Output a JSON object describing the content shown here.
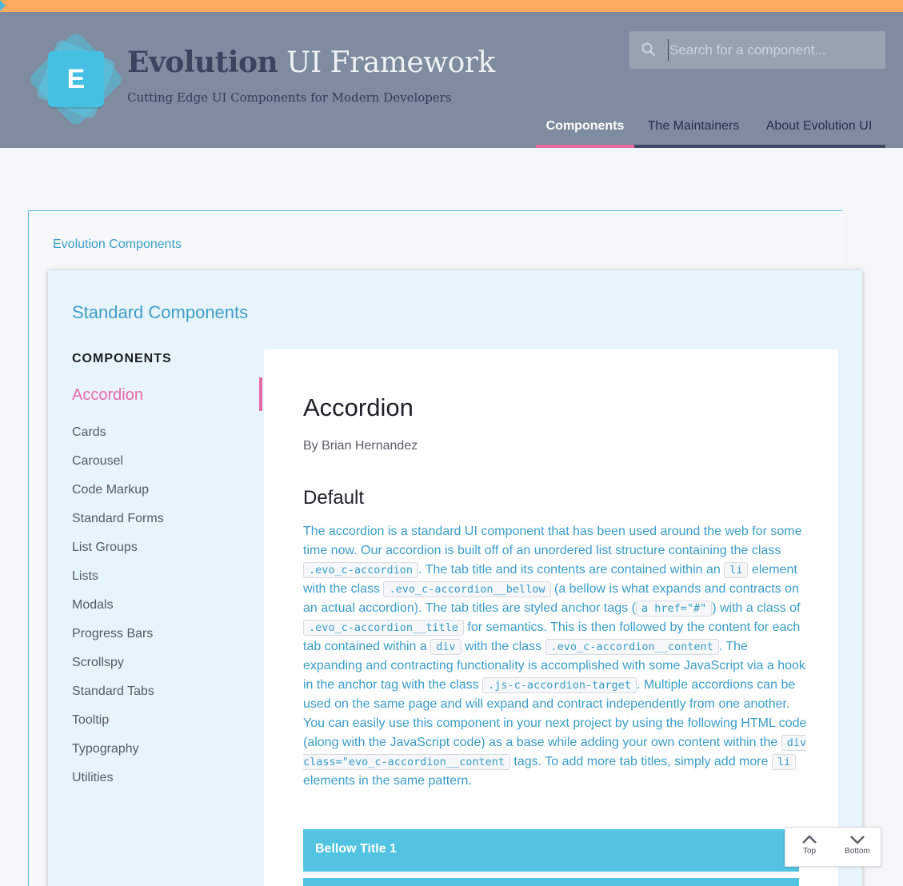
{
  "colors": {
    "accent_pink": "#e86aa4",
    "link_blue": "#3a9dc8",
    "header_bg": "#7f8b9e",
    "bellow_bg": "#52c4e1",
    "stripe": "#fbaa5e"
  },
  "brand": {
    "logo_letter": "E",
    "title_part1": "Evolution",
    "title_part2": "UI Framework",
    "subtitle": "Cutting Edge UI Components for Modern Developers"
  },
  "search": {
    "placeholder": "Search for a component...",
    "icon": "search-icon"
  },
  "nav": {
    "components": "Components",
    "maintainers": "The Maintainers",
    "about": "About Evolution UI"
  },
  "breadcrumb": "Evolution Components",
  "section_title": "Standard Components",
  "sidebar": {
    "heading": "COMPONENTS",
    "items": [
      {
        "label": "Accordion"
      },
      {
        "label": "Cards"
      },
      {
        "label": "Carousel"
      },
      {
        "label": "Code Markup"
      },
      {
        "label": "Standard Forms"
      },
      {
        "label": "List Groups"
      },
      {
        "label": "Lists"
      },
      {
        "label": "Modals"
      },
      {
        "label": "Progress Bars"
      },
      {
        "label": "Scrollspy"
      },
      {
        "label": "Standard Tabs"
      },
      {
        "label": "Tooltip"
      },
      {
        "label": "Typography"
      },
      {
        "label": "Utilities"
      }
    ]
  },
  "content": {
    "title": "Accordion",
    "author": "By Brian Hernandez",
    "subtitle": "Default",
    "desc": {
      "t1": "The accordion is a standard UI component that has been used around the web for some time now. Our accordion is built off of an unordered list structure containing the class ",
      "c1": ".evo_c-accordion",
      "t2": ". The tab title and its contents are contained within an ",
      "c2": "li",
      "t3": " element with the class ",
      "c3": ".evo_c-accordion__bellow",
      "t4": " (a bellow is what expands and contracts on an actual accordion). The tab titles are styled anchor tags (",
      "c4": "a href=\"#\"",
      "t5": ") with a class of ",
      "c5": ".evo_c-accordion__title",
      "t6": " for semantics. This is then followed by the content for each tab contained within a ",
      "c6": "div",
      "t7": " with the class ",
      "c7": ".evo_c-accordion__content",
      "t8": ". The expanding and contracting functionality is accomplished with some JavaScript via a hook in the anchor tag with the class ",
      "c8": ".js-c-accordion-target",
      "t9": ". Multiple accordions can be used on the same page and will expand and contract independently from one another. You can easily use this component in your next project by using the following HTML code (along with the JavaScript code) as a base while adding your own content within the ",
      "c9": "div class=\"evo_c-accordion__content",
      "t10": " tags. To add more tab titles, simply add more ",
      "c10": "li",
      "t11": " elements in the same pattern."
    },
    "bellow1": "Bellow Title 1"
  },
  "scroll": {
    "top": "Top",
    "bottom": "Bottom"
  }
}
